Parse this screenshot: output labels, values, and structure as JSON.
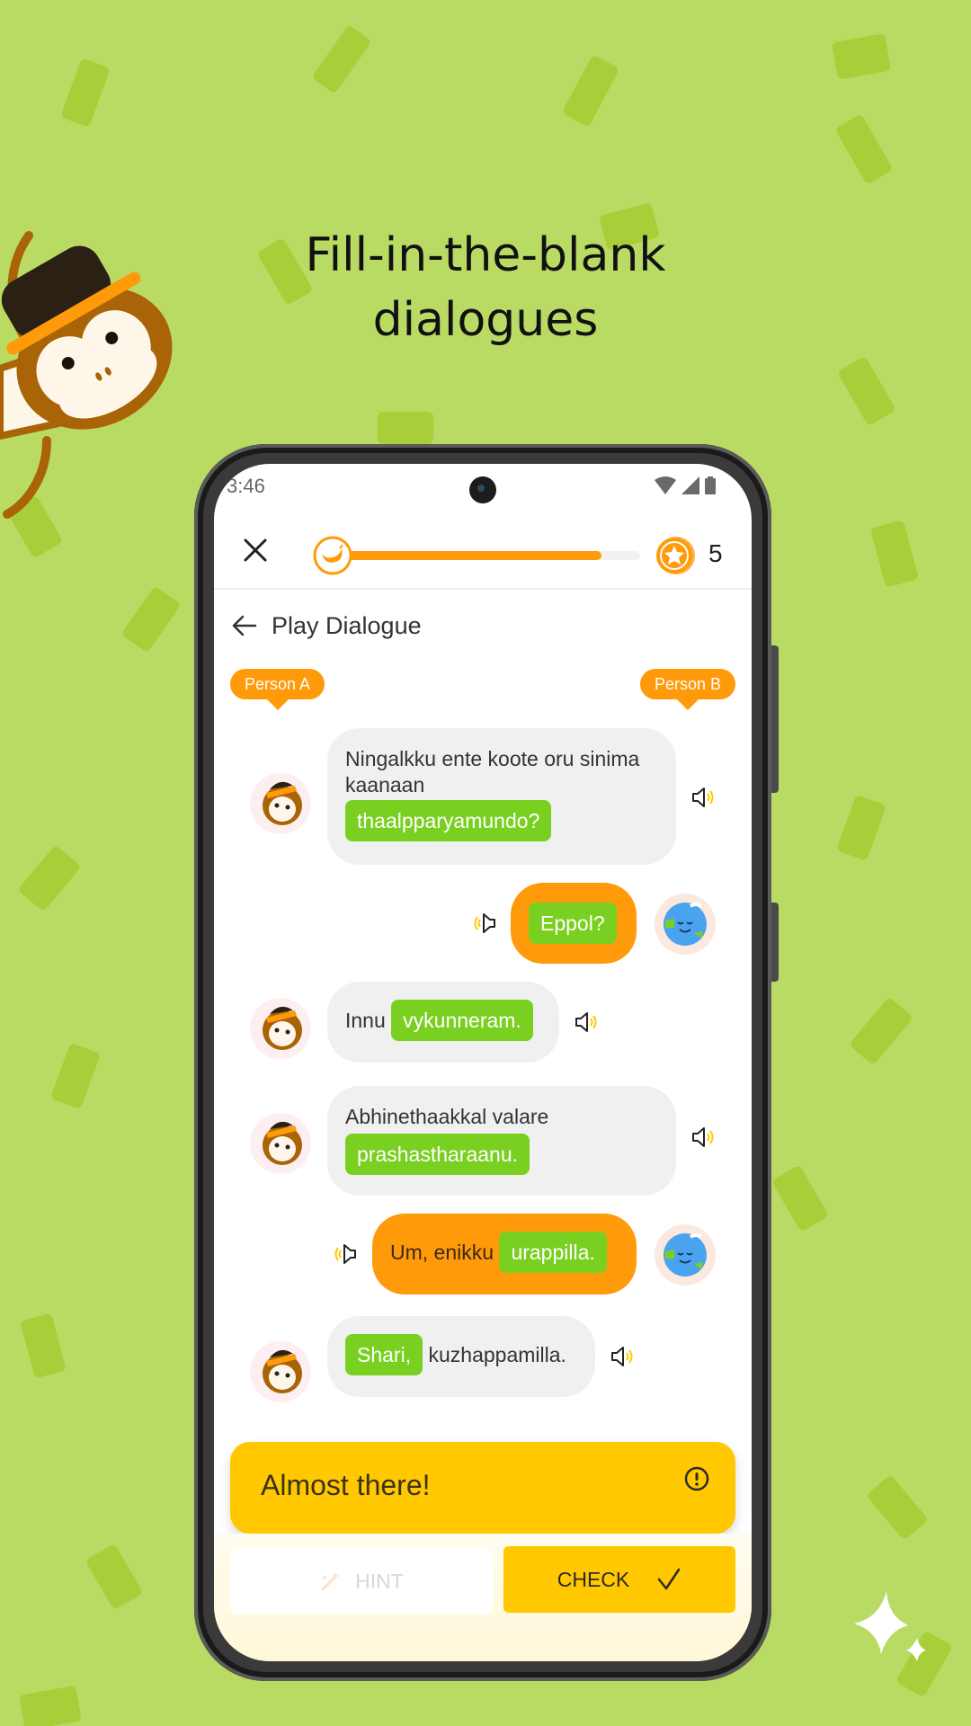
{
  "headline": {
    "line1": "Fill-in-the-blank",
    "line2": "dialogues"
  },
  "status_bar": {
    "time": "3:46",
    "icons": [
      "wifi-icon",
      "signal-icon",
      "battery-icon"
    ]
  },
  "lesson_bar": {
    "progress_percent": 88,
    "coins": "5",
    "accent_color": "#ff9a0a"
  },
  "header": {
    "title": "Play Dialogue"
  },
  "speakers": {
    "a": "Person A",
    "b": "Person B"
  },
  "dialogue": [
    {
      "speaker": "a",
      "text_before": "Ningalkku ente koote oru sinima kaanaan",
      "blank": "thaalpparyamundo?",
      "text_after": ""
    },
    {
      "speaker": "b",
      "text_before": "",
      "blank": "Eppol?",
      "text_after": ""
    },
    {
      "speaker": "a",
      "text_before": "Innu",
      "blank": "vykunneram.",
      "text_after": ""
    },
    {
      "speaker": "a",
      "text_before": "Abhinethaakkal valare",
      "blank": "prashastharaanu.",
      "text_after": ""
    },
    {
      "speaker": "b",
      "text_before": "Um, enikku",
      "blank": "urappilla.",
      "text_after": ""
    },
    {
      "speaker": "a",
      "text_before": "",
      "blank": "Shari,",
      "text_after": "kuzhappamilla."
    }
  ],
  "feedback": {
    "message": "Almost there!"
  },
  "actions": {
    "hint_label": "HINT",
    "check_label": "CHECK"
  },
  "colors": {
    "background": "#badb63",
    "blank": "#79d021",
    "person_b_bubble": "#ff9a0a",
    "feedback": "#ffc800"
  }
}
